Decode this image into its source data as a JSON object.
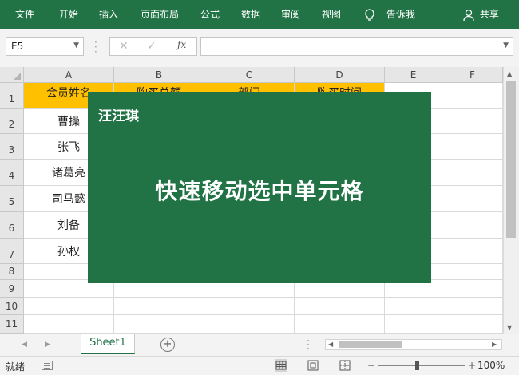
{
  "ribbon": {
    "tabs": [
      "文件",
      "开始",
      "插入",
      "页面布局",
      "公式",
      "数据",
      "审阅",
      "视图"
    ],
    "tell_me": "告诉我",
    "share": "共享",
    "color": "#217346"
  },
  "formula_bar": {
    "name_box": "E5",
    "fx_label": "fx",
    "formula": ""
  },
  "grid": {
    "columns": [
      "A",
      "B",
      "C",
      "D",
      "E",
      "F"
    ],
    "rows": [
      "1",
      "2",
      "3",
      "4",
      "5",
      "6",
      "7",
      "8",
      "9",
      "10",
      "11"
    ],
    "header_row": [
      "会员姓名",
      "购买总额",
      "部门",
      "购买时间"
    ],
    "names": [
      "曹操",
      "张飞",
      "诸葛亮",
      "司马懿",
      "刘备",
      "孙权"
    ],
    "header_color": "#ffc000"
  },
  "sheets": {
    "tabs": [
      "Sheet1"
    ],
    "active": "Sheet1"
  },
  "status": {
    "ready": "就绪",
    "zoom": "100%",
    "zoom_out": "−",
    "zoom_in": "+"
  },
  "overlay": {
    "author": "汪汪琪",
    "headline": "快速移动选中单元格"
  }
}
